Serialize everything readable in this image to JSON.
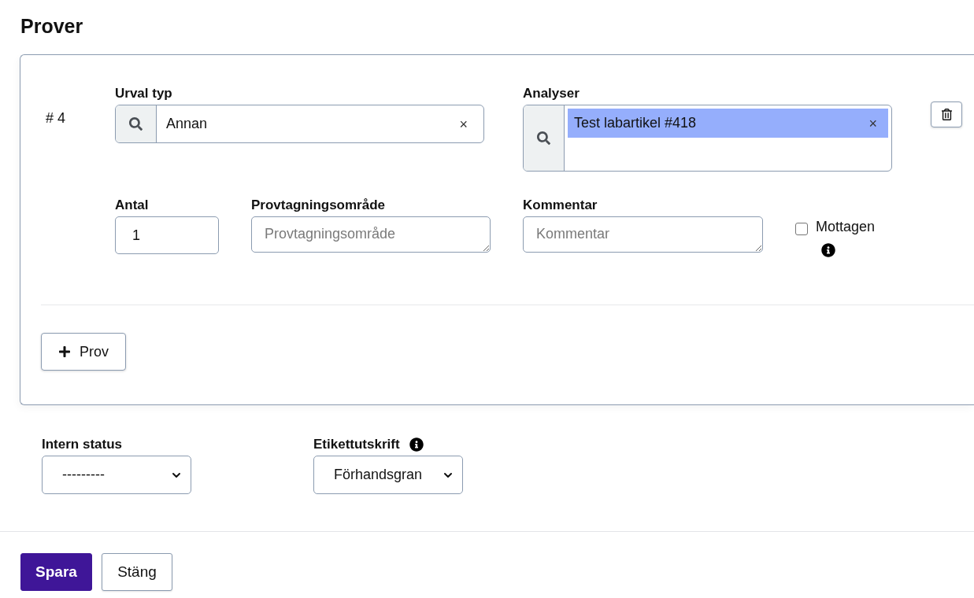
{
  "title": "Prover",
  "sample": {
    "number": "# 4",
    "urval_typ": {
      "label": "Urval typ",
      "value": "Annan",
      "clear": "×"
    },
    "analyser": {
      "label": "Analyser",
      "chips": [
        {
          "text": "Test labartikel #418",
          "remove": "×"
        }
      ]
    },
    "antal": {
      "label": "Antal",
      "value": "1"
    },
    "provtagningsomrade": {
      "label": "Provtagningsområde",
      "placeholder": "Provtagningsområde"
    },
    "kommentar": {
      "label": "Kommentar",
      "placeholder": "Kommentar"
    },
    "mottagen": {
      "label": "Mottagen",
      "checked": false
    }
  },
  "add_button": {
    "label": "Prov"
  },
  "intern_status": {
    "label": "Intern status",
    "value": "---------"
  },
  "etikettutskrift": {
    "label": "Etikettutskrift",
    "value": "Förhandsgran"
  },
  "actions": [
    {
      "label": "Spara",
      "kind": "primary"
    },
    {
      "label": "Stäng",
      "kind": "secondary"
    }
  ]
}
